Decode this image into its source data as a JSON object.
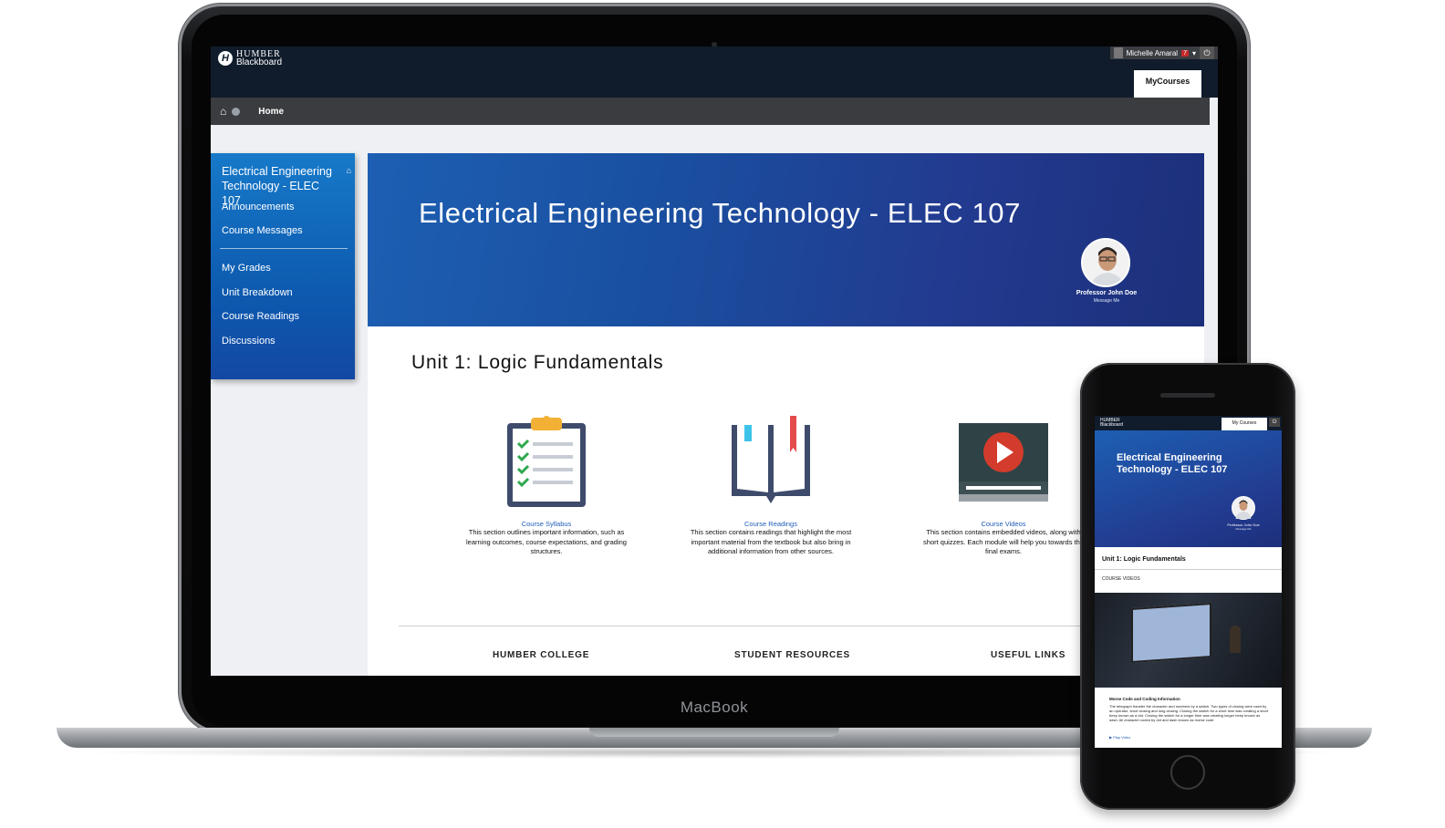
{
  "laptop": {
    "brand": "MacBook"
  },
  "header": {
    "logo_line1": "HUMBER",
    "logo_line2": "Blackboard",
    "user_name": "Michelle Amaral",
    "notification_count": "7",
    "tab_label": "MyCourses",
    "breadcrumb_home": "Home"
  },
  "course_menu": {
    "title": "Electrical Engineering Technology - ELEC 107",
    "items": [
      "Announcements",
      "Course Messages",
      "My Grades",
      "Unit Breakdown",
      "Course Readings",
      "Discussions"
    ]
  },
  "banner": {
    "title": "Electrical Engineering Technology - ELEC 107",
    "professor_name": "Professor John Doe",
    "message_link": "Message Me"
  },
  "unit": {
    "title": "Unit 1: Logic Fundamentals"
  },
  "resources": [
    {
      "icon": "clipboard-checklist-icon",
      "link": "Course Syllabus",
      "description": "This section outlines important information, such as learning outcomes, course expectations, and grading structures."
    },
    {
      "icon": "open-book-icon",
      "link": "Course Readings",
      "description": "This section contains readings that highlight the most important material from the textbook but also bring in additional information from other sources."
    },
    {
      "icon": "video-play-icon",
      "link": "Course Videos",
      "description": "This section contains embedded videos, along with short quizzes. Each module will help you towards the final exams."
    }
  ],
  "footer": {
    "col1": "HUMBER COLLEGE",
    "col2": "STUDENT RESOURCES",
    "col3": "USEFUL LINKS"
  },
  "phone": {
    "logo_line1": "HUMBER",
    "logo_line2": "Blackboard",
    "tab_label": "My Courses",
    "banner_title": "Electrical Engineering Technology - ELEC 107",
    "professor_name": "Professor John Doe",
    "message_link": "Message Me",
    "unit_title": "Unit 1: Logic Fundamentals",
    "section_label": "COURSE VIDEOS",
    "video_title": "Morse Code and Coding Information",
    "video_description": "The telegraph transfer the character and numbers by a switch. Two types of closing were used by an operator, short closing and long closing. Closing the switch for a short time was creating a short beep known as a dot. Closing the switch for a longer time was creating longer beep known as dash. All character coded by dot and dash known as morse code",
    "play_label": "Play Video"
  },
  "colors": {
    "banner_start": "#1d5fb3",
    "banner_end": "#1c2f7a",
    "menu_blue": "#0d5bb0",
    "link_blue": "#1f5db8",
    "topbar": "#101b2b",
    "play_red": "#d33b2c"
  }
}
